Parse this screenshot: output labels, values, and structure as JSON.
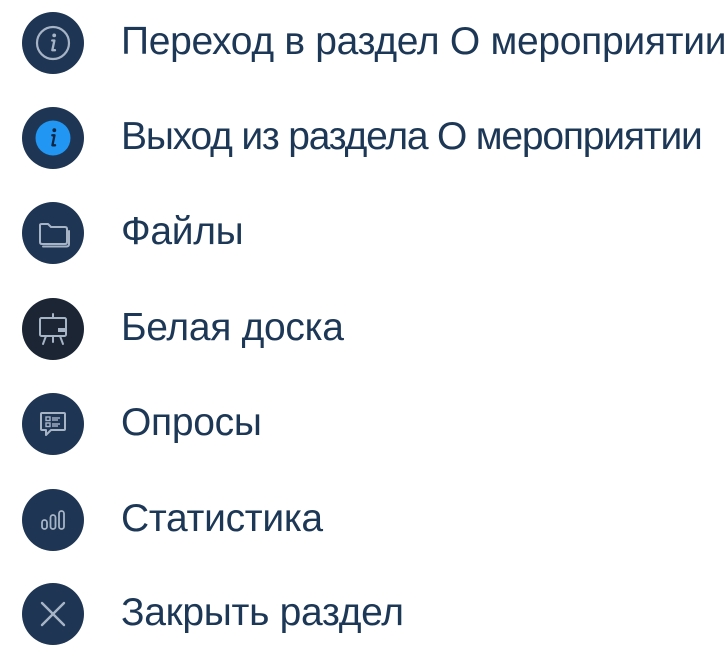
{
  "colors": {
    "icon_background": "#1e3554",
    "icon_active_background": "#2196f3",
    "icon_stroke": "#a7b4c6",
    "label_text": "#1d3857"
  },
  "legend": {
    "items": [
      {
        "icon": "info-circle-icon",
        "label": "Переход в раздел О мероприятии"
      },
      {
        "icon": "info-active-icon",
        "label": "Выход из раздела О мероприятии"
      },
      {
        "icon": "folder-icon",
        "label": "Файлы"
      },
      {
        "icon": "whiteboard-icon",
        "label": "Белая доска"
      },
      {
        "icon": "poll-icon",
        "label": "Опросы"
      },
      {
        "icon": "statistics-icon",
        "label": "Статистика"
      },
      {
        "icon": "close-icon",
        "label": "Закрыть раздел"
      }
    ]
  }
}
